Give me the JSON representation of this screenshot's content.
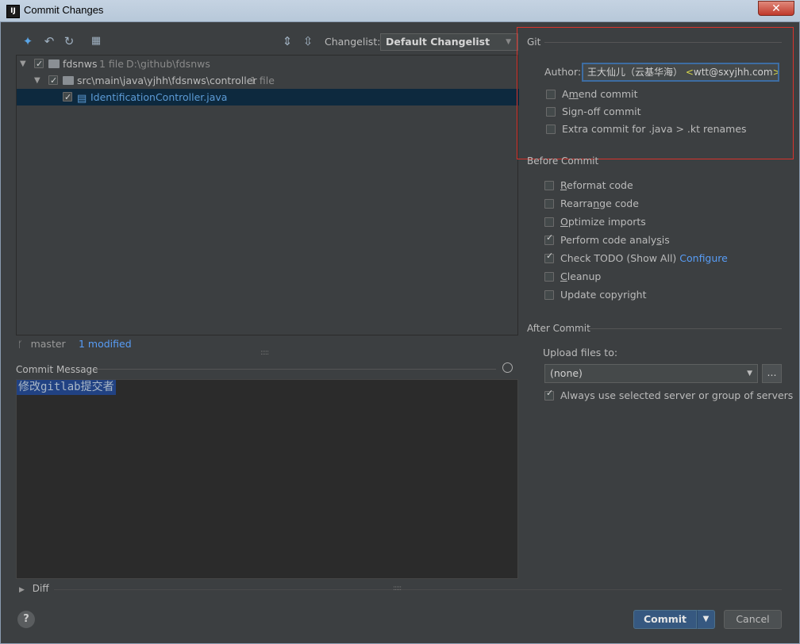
{
  "window": {
    "title": "Commit Changes",
    "app_icon": "IJ"
  },
  "toolbar": {
    "icons": [
      "show-diff-icon",
      "rollback-icon",
      "refresh-icon",
      "group-by-icon",
      "expand-all-icon",
      "collapse-all-icon"
    ],
    "changelist_label": "Changelist:",
    "changelist_value": "Default Changelist"
  },
  "tree": {
    "root": {
      "name": "fdsnws",
      "count": "1 file",
      "path": "D:\\github\\fdsnws"
    },
    "folder": {
      "name": "src\\main\\java\\yjhh\\fdsnws\\controller",
      "count": "1 file"
    },
    "file": {
      "name": "IdentificationController.java"
    }
  },
  "status": {
    "branch": "master",
    "modified": "1 modified"
  },
  "commit_message": {
    "label": "Commit Message",
    "text": "修改gitlab提交者"
  },
  "diff": {
    "label": "Diff"
  },
  "git": {
    "title": "Git",
    "author_label": "Author:",
    "author_name": "王大仙儿（云基华海）",
    "author_lt": "<",
    "author_email": "wtt@sxyjhh.com",
    "author_gt": ">",
    "options": [
      {
        "pre": "A",
        "ul": "m",
        "post": "end commit",
        "checked": false
      },
      {
        "pre": "Si",
        "ul": "g",
        "post": "n-off commit",
        "checked": false
      },
      {
        "pre": "Extra commit for .java > .kt renames",
        "ul": "",
        "post": "",
        "checked": false
      }
    ]
  },
  "before_commit": {
    "title": "Before Commit",
    "options": [
      {
        "pre": "",
        "ul": "R",
        "post": "eformat code",
        "checked": false
      },
      {
        "pre": "Rearra",
        "ul": "n",
        "post": "ge code",
        "checked": false
      },
      {
        "pre": "",
        "ul": "O",
        "post": "ptimize imports",
        "checked": false
      },
      {
        "pre": "Perform code analy",
        "ul": "s",
        "post": "is",
        "checked": true
      },
      {
        "pre": "Check TODO (Show All) ",
        "ul": "",
        "post": "",
        "checked": true,
        "link": "Configure"
      },
      {
        "pre": "",
        "ul": "C",
        "post": "leanup",
        "checked": false
      },
      {
        "pre": "Update copyright",
        "ul": "",
        "post": "",
        "checked": false
      }
    ]
  },
  "after_commit": {
    "title": "After Commit",
    "upload_label": "Upload files to:",
    "upload_value": "(none)",
    "browse_label": "...",
    "always_use": {
      "label": "Always use selected server or group of servers",
      "checked": true
    }
  },
  "buttons": {
    "help": "?",
    "commit": "Commit",
    "cancel": "Cancel"
  },
  "colors": {
    "accent": "#589df6",
    "highlight_box": "#d9332c",
    "selection": "#0d293e",
    "primary_button": "#365880"
  }
}
